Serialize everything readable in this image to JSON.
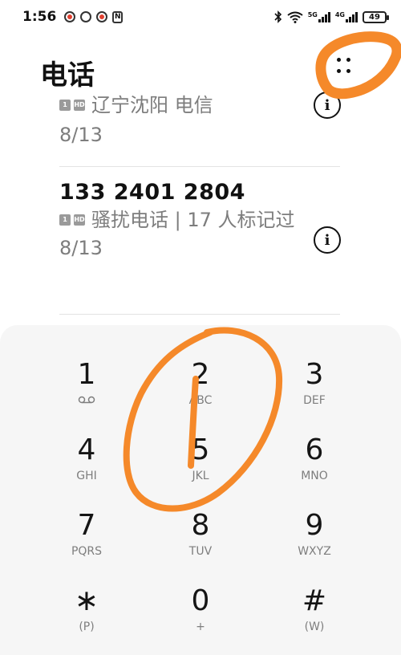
{
  "status_bar": {
    "time": "1:56",
    "network1": "5G",
    "network2": "4G",
    "battery": "49"
  },
  "header": {
    "title": "电话"
  },
  "calls": [
    {
      "number": "",
      "sim": "1",
      "hd": "HD",
      "location": "辽宁沈阳 电信",
      "date": "8/13"
    },
    {
      "number": "133 2401 2804",
      "sim": "1",
      "hd": "HD",
      "location": "骚扰电话 | 17 人标记过",
      "date": "8/13"
    }
  ],
  "dialpad": {
    "keys": [
      {
        "digit": "1",
        "letters": ""
      },
      {
        "digit": "2",
        "letters": "ABC"
      },
      {
        "digit": "3",
        "letters": "DEF"
      },
      {
        "digit": "4",
        "letters": "GHI"
      },
      {
        "digit": "5",
        "letters": "JKL"
      },
      {
        "digit": "6",
        "letters": "MNO"
      },
      {
        "digit": "7",
        "letters": "PQRS"
      },
      {
        "digit": "8",
        "letters": "TUV"
      },
      {
        "digit": "9",
        "letters": "WXYZ"
      },
      {
        "digit": "∗",
        "letters": "(P)"
      },
      {
        "digit": "0",
        "letters": "+"
      },
      {
        "digit": "#",
        "letters": "(W)"
      }
    ]
  },
  "colors": {
    "annotation": "#f5892a",
    "secondary_text": "#7d7d7d",
    "dialpad_bg": "#f6f6f6"
  },
  "icons": [
    "bluetooth-icon",
    "wifi-icon",
    "signal-icon",
    "battery-icon",
    "more-icon",
    "info-icon",
    "voicemail-icon"
  ]
}
